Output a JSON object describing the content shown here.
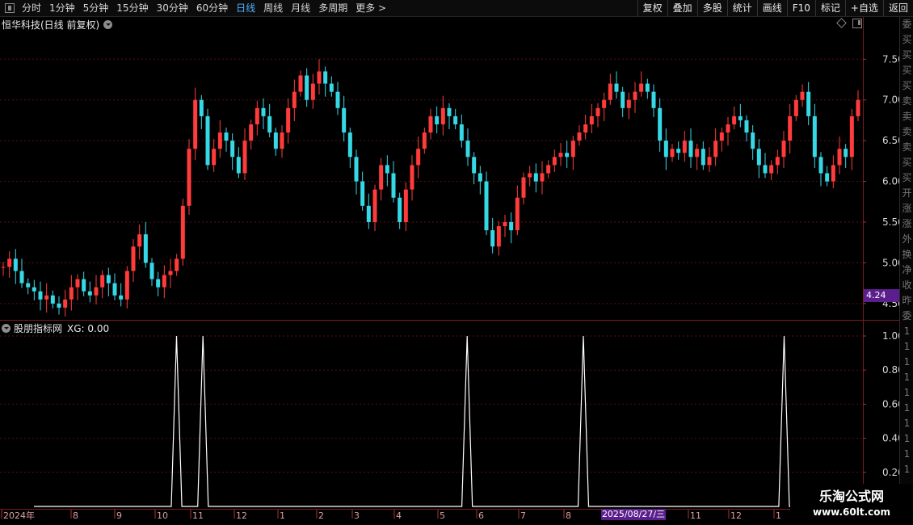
{
  "toolbar": {
    "periods": [
      "分时",
      "1分钟",
      "5分钟",
      "15分钟",
      "30分钟",
      "60分钟",
      "日线",
      "周线",
      "月线",
      "多周期",
      "更多 >"
    ],
    "active_period": "日线",
    "buttons": [
      "复权",
      "叠加",
      "多股",
      "统计",
      "画线",
      "F10",
      "标记",
      "+自选",
      "返回"
    ]
  },
  "main_panel": {
    "title": "恒华科技(日线 前复权)",
    "y_ticks": [
      "7.50",
      "7.00",
      "6.50",
      "6.00",
      "5.50",
      "5.00",
      "4.50"
    ],
    "y_tick_values": [
      7.5,
      7.0,
      6.5,
      6.0,
      5.5,
      5.0,
      4.5
    ],
    "price_tag": "4.24"
  },
  "indicator_panel": {
    "title": "股朋指标网",
    "value_label": "XG: 0.00",
    "y_ticks": [
      "1.00",
      "0.80",
      "0.60",
      "0.40",
      "0.20"
    ],
    "y_tick_values": [
      1.0,
      0.8,
      0.6,
      0.4,
      0.2
    ]
  },
  "date_axis": {
    "labels": [
      "2024年",
      "8",
      "9",
      "10",
      "11",
      "12",
      "1",
      "2",
      "3",
      "4",
      "5",
      "6",
      "7",
      "8",
      "11",
      "12",
      "1"
    ],
    "crosshair_date": "2025/08/27/三"
  },
  "right_strip_chars": [
    "委",
    "买",
    "买",
    "买",
    "买",
    "卖",
    "卖",
    "卖",
    "卖",
    "买",
    "买",
    "开",
    "涨",
    "涨",
    "外",
    "换",
    "净",
    "收",
    "昨",
    "委",
    "1",
    "1",
    "1",
    "1",
    "1",
    "1",
    "1",
    "1",
    "1",
    "1"
  ],
  "watermark": {
    "title": "乐淘公式网",
    "url": "www.60lt.com"
  },
  "colors": {
    "up": "#ff3b3b",
    "down": "#36d8e6",
    "grid": "#5a0f0f",
    "signal": "#ffffff"
  },
  "chart_data": [
    {
      "type": "candlestick",
      "title": "恒华科技(日线 前复权)",
      "series": [
        {
          "name": "恒华科技",
          "values": [
            4.95,
            5.05,
            4.9,
            4.75,
            4.7,
            4.65,
            4.55,
            4.6,
            4.5,
            4.45,
            4.55,
            4.7,
            4.8,
            4.65,
            4.6,
            4.7,
            4.85,
            4.75,
            4.6,
            4.55,
            4.9,
            5.2,
            5.35,
            5.0,
            4.8,
            4.7,
            4.85,
            4.9,
            5.05,
            5.7,
            6.4,
            7.0,
            6.8,
            6.2,
            6.4,
            6.6,
            6.5,
            6.3,
            6.1,
            6.5,
            6.7,
            6.9,
            6.8,
            6.6,
            6.4,
            6.6,
            6.9,
            7.1,
            7.3,
            7.0,
            7.2,
            7.35,
            7.2,
            7.1,
            6.9,
            6.6,
            6.3,
            6.0,
            5.7,
            5.5,
            5.9,
            6.2,
            6.1,
            5.8,
            5.5,
            5.9,
            6.2,
            6.4,
            6.6,
            6.8,
            6.7,
            6.9,
            6.8,
            6.7,
            6.5,
            6.3,
            6.1,
            6.0,
            5.4,
            5.2,
            5.45,
            5.5,
            5.4,
            5.8,
            6.05,
            6.1,
            6.0,
            6.1,
            6.2,
            6.3,
            6.35,
            6.3,
            6.5,
            6.6,
            6.7,
            6.8,
            6.9,
            7.0,
            7.2,
            7.1,
            6.9,
            7.0,
            7.1,
            7.2,
            7.1,
            6.9,
            6.5,
            6.3,
            6.4,
            6.35,
            6.5,
            6.3,
            6.4,
            6.2,
            6.3,
            6.5,
            6.6,
            6.7,
            6.8,
            6.75,
            6.6,
            6.4,
            6.2,
            6.1,
            6.2,
            6.3,
            6.5,
            6.8,
            7.0,
            7.1,
            6.8,
            6.3,
            6.1,
            6.0,
            6.2,
            6.4,
            6.3,
            6.8,
            7.0
          ]
        }
      ],
      "ylim": [
        4.3,
        7.85
      ]
    },
    {
      "type": "line",
      "title": "股朋指标网",
      "series": [
        {
          "name": "XG",
          "values": [
            0,
            0,
            0,
            0,
            0,
            0,
            0,
            0,
            0,
            0,
            0,
            0,
            0,
            0,
            0,
            0,
            0,
            0,
            0,
            0,
            0,
            0,
            0,
            0,
            0,
            0,
            0,
            1,
            0,
            0,
            0,
            0,
            1,
            0,
            0,
            0,
            0,
            0,
            0,
            0,
            0,
            0,
            0,
            0,
            0,
            0,
            0,
            0,
            0,
            0,
            0,
            0,
            0,
            0,
            0,
            0,
            0,
            0,
            0,
            0,
            0,
            0,
            0,
            0,
            0,
            0,
            0,
            0,
            0,
            0,
            0,
            0,
            0,
            0,
            0,
            0,
            0,
            0,
            0,
            0,
            0,
            0,
            1,
            0,
            0,
            0,
            0,
            0,
            0,
            0,
            0,
            0,
            0,
            0,
            0,
            0,
            0,
            0,
            0,
            0,
            0,
            0,
            0,
            0,
            1,
            0,
            0,
            0,
            0,
            0,
            0,
            0,
            0,
            0,
            0,
            0,
            0,
            0,
            0,
            0,
            0,
            0,
            0,
            0,
            0,
            0,
            0,
            0,
            0,
            0,
            0,
            0,
            0,
            0,
            0,
            0,
            0,
            0,
            0,
            0,
            0,
            0,
            1,
            0,
            0,
            0,
            0,
            0,
            0,
            0,
            0,
            0,
            0,
            0,
            0,
            0,
            0
          ]
        }
      ],
      "ylim": [
        0,
        1.0
      ]
    }
  ]
}
